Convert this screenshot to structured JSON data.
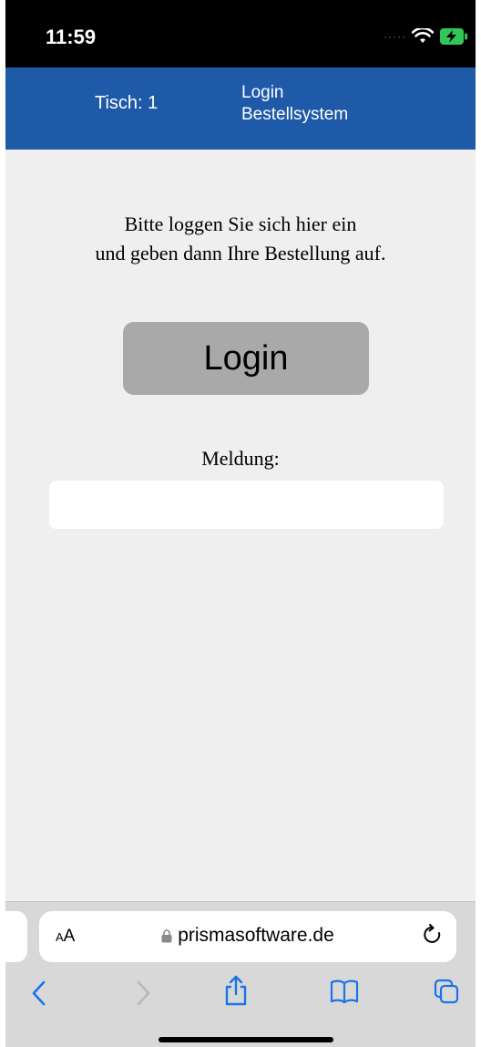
{
  "status_bar": {
    "time": "11:59",
    "icons": [
      "signal-dots-icon",
      "wifi-icon",
      "battery-charging-icon"
    ]
  },
  "header": {
    "table_label": "Tisch: 1",
    "title_line1": "Login",
    "title_line2": "Bestellsystem",
    "background_color": "#1f5aa8"
  },
  "main": {
    "intro_line1": "Bitte loggen Sie sich hier ein",
    "intro_line2": "und geben dann Ihre Bestellung auf.",
    "login_button_label": "Login",
    "message_label": "Meldung:",
    "message_value": ""
  },
  "browser": {
    "text_size_label_big": "A",
    "text_size_label_small": "A",
    "url": "prismasoftware.de",
    "toolbar": [
      "back-icon",
      "forward-icon",
      "share-icon",
      "bookmarks-icon",
      "tabs-icon"
    ],
    "accent_color": "#1a73e8"
  }
}
